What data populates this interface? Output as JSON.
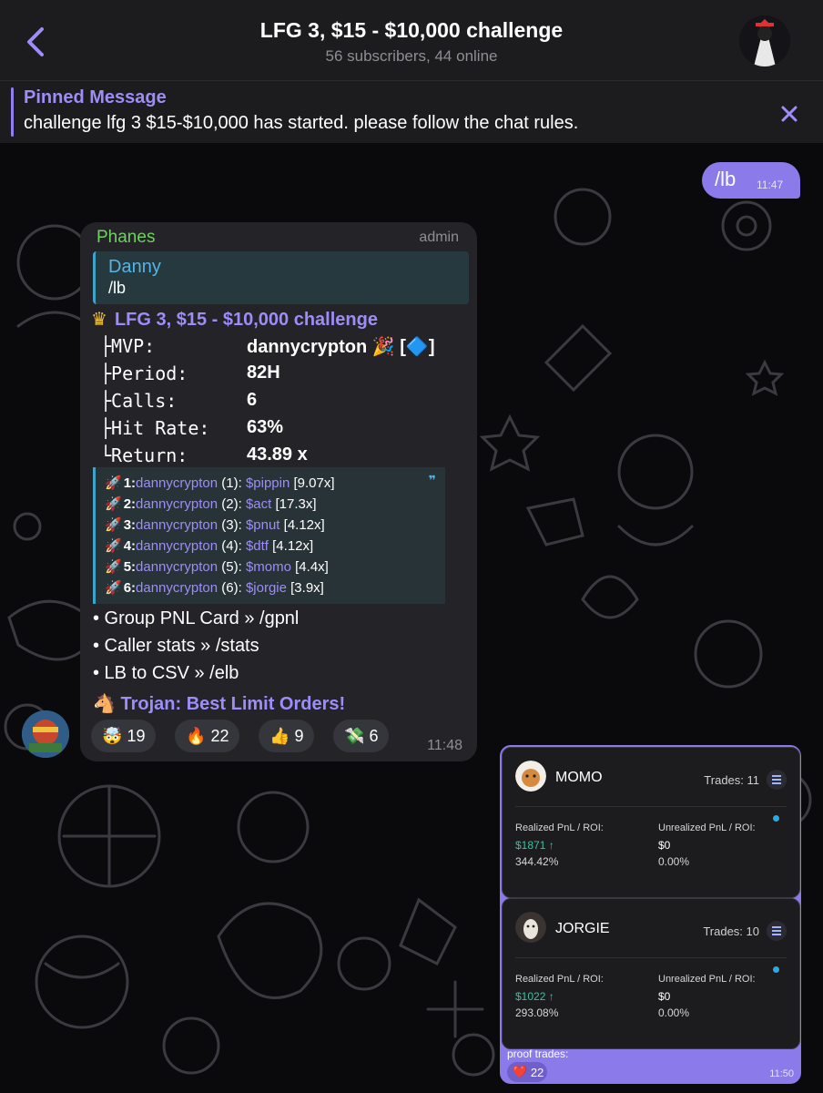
{
  "header": {
    "title": "LFG 3, $15 - $10,000 challenge",
    "subtitle": "56 subscribers, 44 online"
  },
  "pinned": {
    "label": "Pinned Message",
    "text": "challenge lfg 3 $15-$10,000 has started. please follow the chat rules."
  },
  "outgoing": {
    "text": "/lb",
    "time": "11:47"
  },
  "message": {
    "sender": "Phanes",
    "role": "admin",
    "reply": {
      "name": "Danny",
      "text": "/lb"
    },
    "headline": "LFG 3, $15 - $10,000 challenge",
    "stats": [
      {
        "key": "├MVP:",
        "value": "dannycrypton 🎉 [🔷]"
      },
      {
        "key": "├Period:",
        "value": "82H"
      },
      {
        "key": "├Calls:",
        "value": "6"
      },
      {
        "key": "├Hit Rate:",
        "value": "63%"
      },
      {
        "key": "└Return:",
        "value": "43.89 x"
      }
    ],
    "leaderboard": [
      {
        "rank": "1:",
        "name": "dannycrypton",
        "count": "(1):",
        "ticker": "$pippin",
        "mult": "[9.07x]"
      },
      {
        "rank": "2:",
        "name": "dannycrypton",
        "count": "(2):",
        "ticker": "$act",
        "mult": "[17.3x]"
      },
      {
        "rank": "3:",
        "name": "dannycrypton",
        "count": "(3):",
        "ticker": "$pnut",
        "mult": "[4.12x]"
      },
      {
        "rank": "4:",
        "name": "dannycrypton",
        "count": "(4):",
        "ticker": "$dtf",
        "mult": "[4.12x]"
      },
      {
        "rank": "5:",
        "name": "dannycrypton",
        "count": "(5):",
        "ticker": "$momo",
        "mult": "[4.4x]"
      },
      {
        "rank": "6:",
        "name": "dannycrypton",
        "count": "(6):",
        "ticker": "$jorgie",
        "mult": "[3.9x]"
      }
    ],
    "quote_mark": "❞",
    "links": [
      "• Group PNL Card » /gpnl",
      "• Caller stats » /stats",
      "• LB to CSV » /elb"
    ],
    "promo": "Trojan: Best Limit Orders!",
    "reactions": [
      {
        "emoji": "🤯",
        "count": "19"
      },
      {
        "emoji": "🔥",
        "count": "22"
      },
      {
        "emoji": "👍",
        "count": "9"
      },
      {
        "emoji": "💸",
        "count": "6"
      }
    ],
    "time": "11:48"
  },
  "image_message": {
    "cards": [
      {
        "name": "MOMO",
        "trades": "Trades: 11",
        "realized_label": "Realized PnL / ROI:",
        "realized_value": "$1871 ↑",
        "realized_roi": "344.42%",
        "unrealized_label": "Unrealized PnL / ROI:",
        "unrealized_value": "$0",
        "unrealized_roi": "0.00%"
      },
      {
        "name": "JORGIE",
        "trades": "Trades: 10",
        "realized_label": "Realized PnL / ROI:",
        "realized_value": "$1022  ↑",
        "realized_roi": "293.08%",
        "unrealized_label": "Unrealized PnL / ROI:",
        "unrealized_value": "$0",
        "unrealized_roi": "0.00%"
      }
    ],
    "caption": "proof trades:",
    "reaction": {
      "emoji": "❤️",
      "count": "22"
    },
    "time": "11:50"
  },
  "colors": {
    "accent": "#8b7ae9",
    "link": "#9d8df8",
    "sender_green": "#6fcf62",
    "reply_blue": "#56b4e4",
    "positive": "#3fbfa0"
  }
}
